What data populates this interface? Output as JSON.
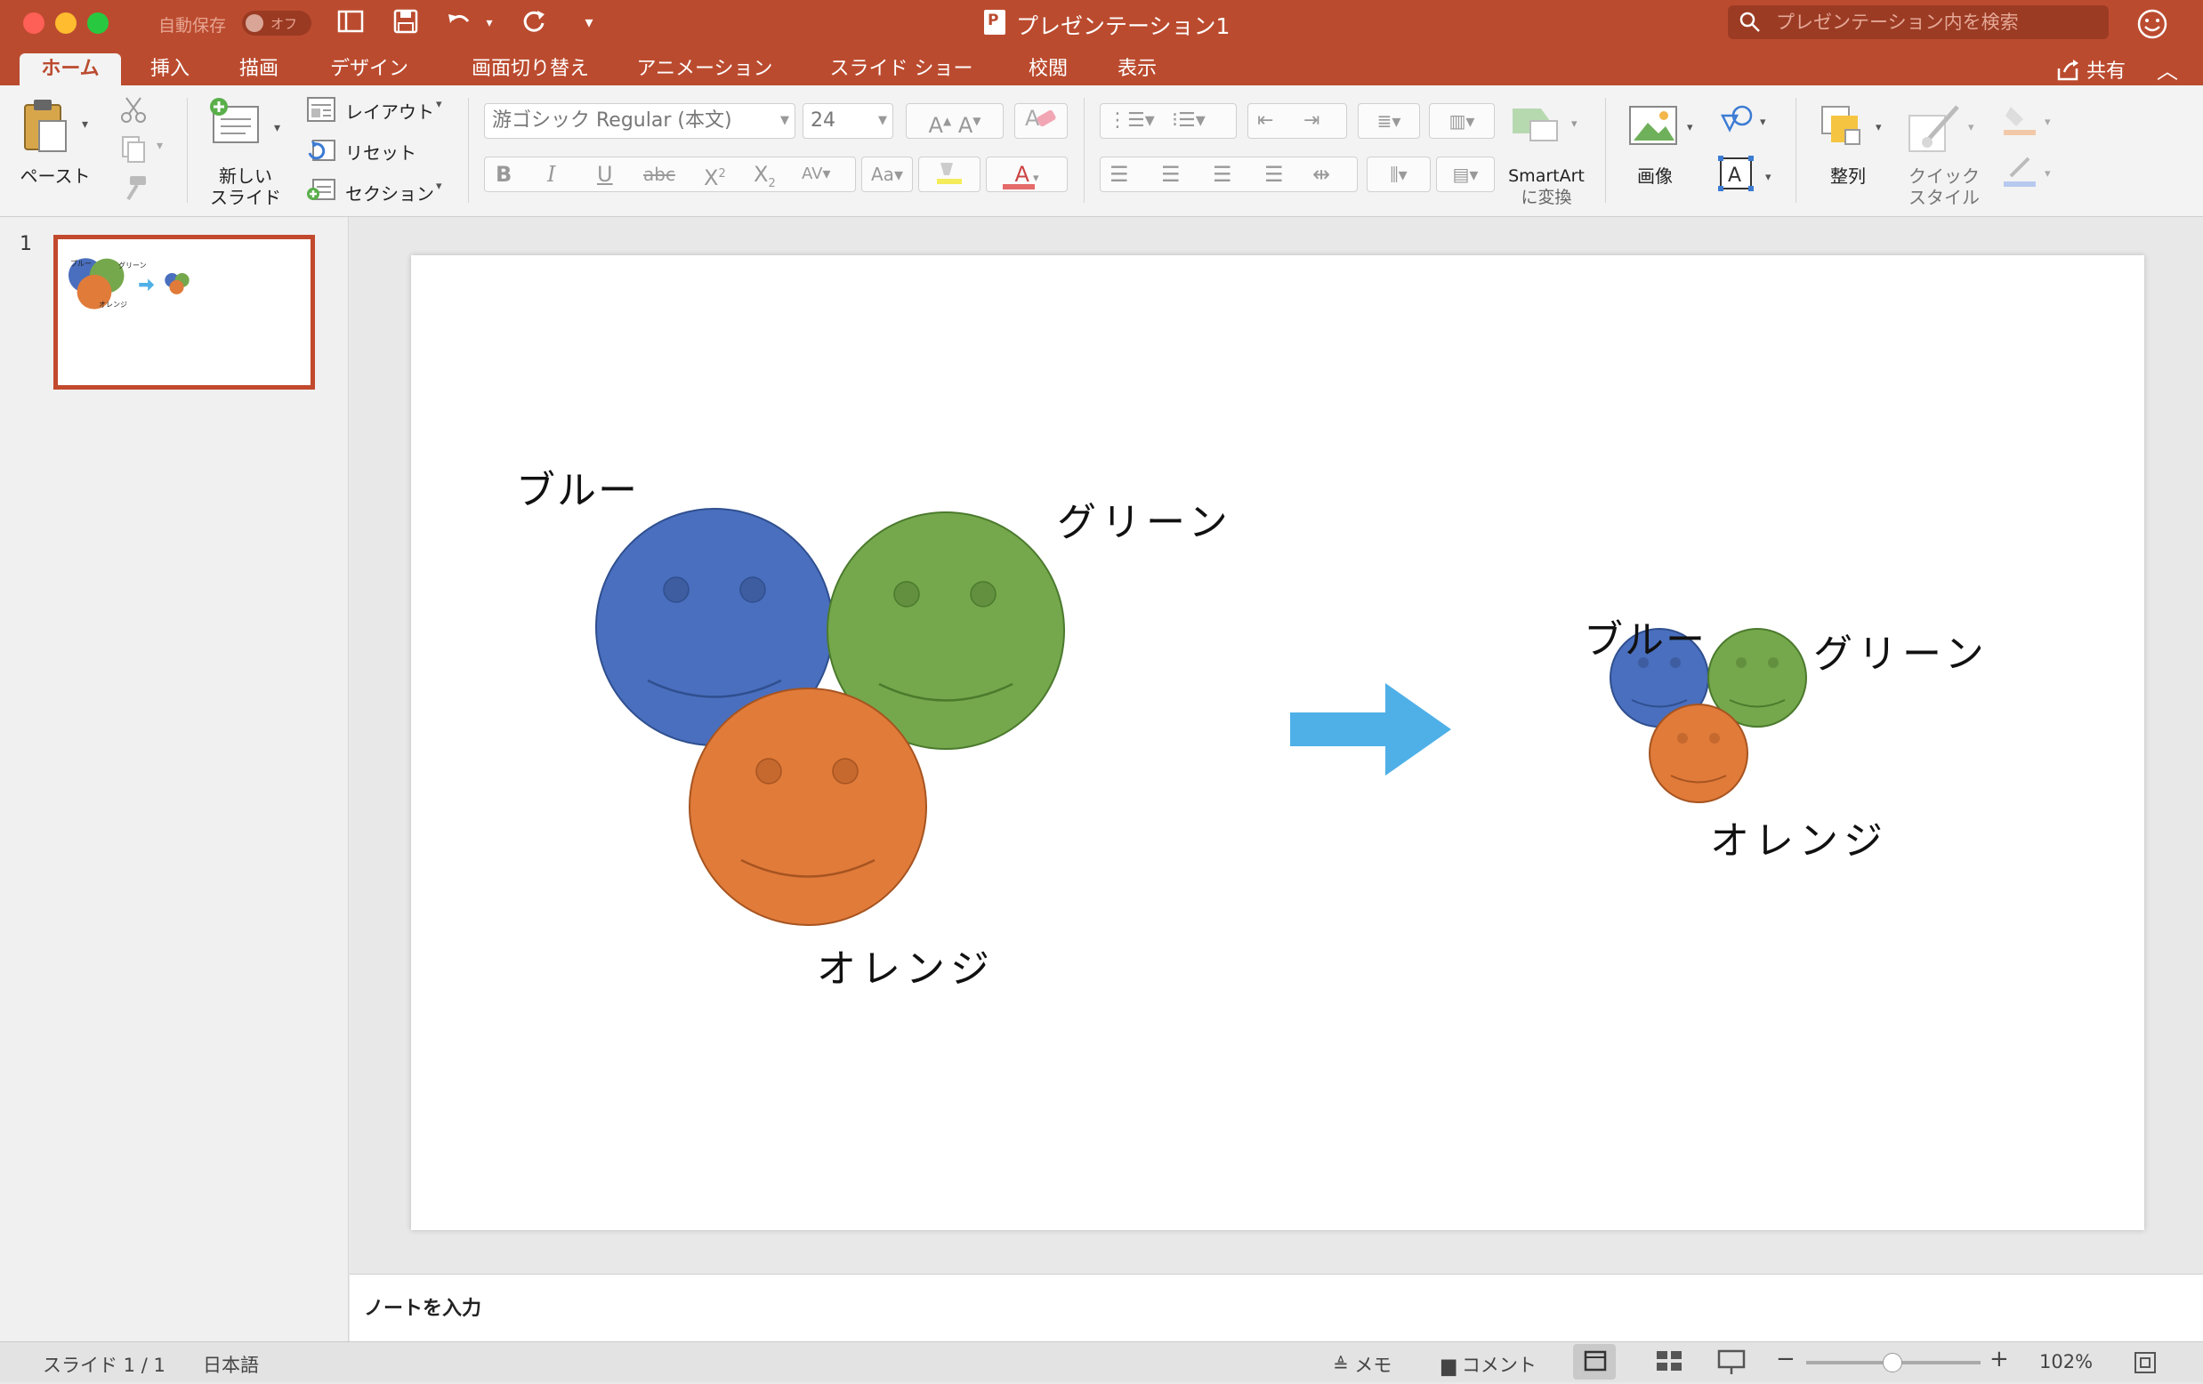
{
  "titlebar": {
    "autosave_label": "自動保存",
    "autosave_state": "オフ",
    "document_title": "プレゼンテーション1",
    "search_placeholder": "プレゼンテーション内を検索"
  },
  "tabs": [
    "ホーム",
    "挿入",
    "描画",
    "デザイン",
    "画面切り替え",
    "アニメーション",
    "スライド ショー",
    "校閲",
    "表示"
  ],
  "active_tab": "ホーム",
  "share_label": "共有",
  "ribbon": {
    "paste": "ペースト",
    "new_slide_line1": "新しい",
    "new_slide_line2": "スライド",
    "layout": "レイアウト",
    "reset": "リセット",
    "section": "セクション",
    "font_name": "游ゴシック Regular (本文)",
    "font_size": "24",
    "smartart_line1": "SmartArt",
    "smartart_line2": "に変換",
    "picture": "画像",
    "arrange": "整列",
    "quick_style_line1": "クイック",
    "quick_style_line2": "スタイル"
  },
  "thumbnail": {
    "slide_number": "1",
    "labels": {
      "blue": "ブルー",
      "green": "グリーン",
      "orange": "オレンジ"
    }
  },
  "slide": {
    "large_labels": {
      "blue": "ブルー",
      "green": "グリーン",
      "orange": "オレンジ"
    },
    "small_labels": {
      "blue": "ブルー",
      "green": "グリーン",
      "orange": "オレンジ"
    },
    "colors": {
      "blue": "#4a6fbe",
      "green": "#75a84c",
      "orange": "#e17b3a",
      "arrow": "#4fb0e8"
    }
  },
  "notes_placeholder": "ノートを入力",
  "status": {
    "slide_info": "スライド 1 / 1",
    "language": "日本語",
    "notes_button": "メモ",
    "comments_button": "コメント",
    "zoom": "102%"
  }
}
